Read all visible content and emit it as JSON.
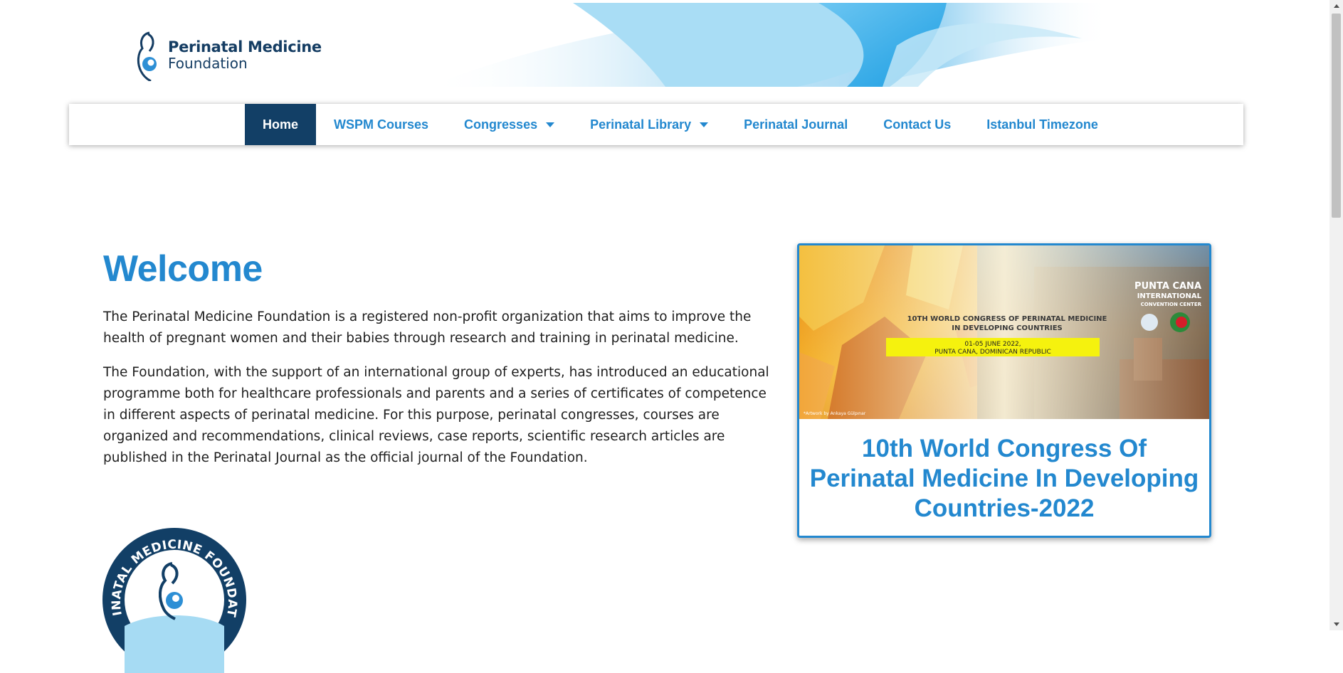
{
  "brand": {
    "name_line1": "Perinatal Medicine",
    "name_line2": "Foundation",
    "colors": {
      "primary": "#2388cf",
      "dark": "#123f66",
      "text": "#1e1e1e"
    }
  },
  "nav": {
    "items": [
      {
        "label": "Home",
        "active": true
      },
      {
        "label": "WSPM Courses"
      },
      {
        "label": "Congresses",
        "dropdown": true
      },
      {
        "label": "Perinatal Library",
        "dropdown": true
      },
      {
        "label": "Perinatal Journal"
      },
      {
        "label": "Contact Us"
      },
      {
        "label": "Istanbul Timezone"
      }
    ]
  },
  "main": {
    "heading": "Welcome",
    "paragraphs": [
      "The Perinatal  Medicine Foundation is a registered non-profit organization that aims to improve the health of pregnant women and their babies through research and training in perinatal medicine.",
      "The Foundation, with the support of an international group of experts, has introduced an educational programme both for healthcare professionals and parents and a series of certificates of competence in different aspects of perinatal medicine. For this purpose, perinatal congresses, courses are organized and recommendations, clinical reviews, case reports, scientific research articles are published in the Perinatal Journal as the official journal of the Foundation."
    ],
    "badge_text": "PERINATAL MEDICINE FOUNDATION"
  },
  "card": {
    "banner": {
      "headline_line1": "10TH WORLD CONGRESS OF PERINATAL MEDICINE",
      "headline_line2": "IN DEVELOPING COUNTRIES",
      "date_line": "01-05 JUNE 2022,",
      "place_line": "PUNTA CANA, DOMINICAN REPUBLIC",
      "venue_line1": "PUNTA CANA",
      "venue_line2": "INTERNATIONAL",
      "venue_line3": "CONVENTION CENTER",
      "credit": "*Artwork by Ankaya Gülpınar"
    },
    "title": "10th World Congress Of Perinatal Medicine In Developing Countries-2022"
  }
}
